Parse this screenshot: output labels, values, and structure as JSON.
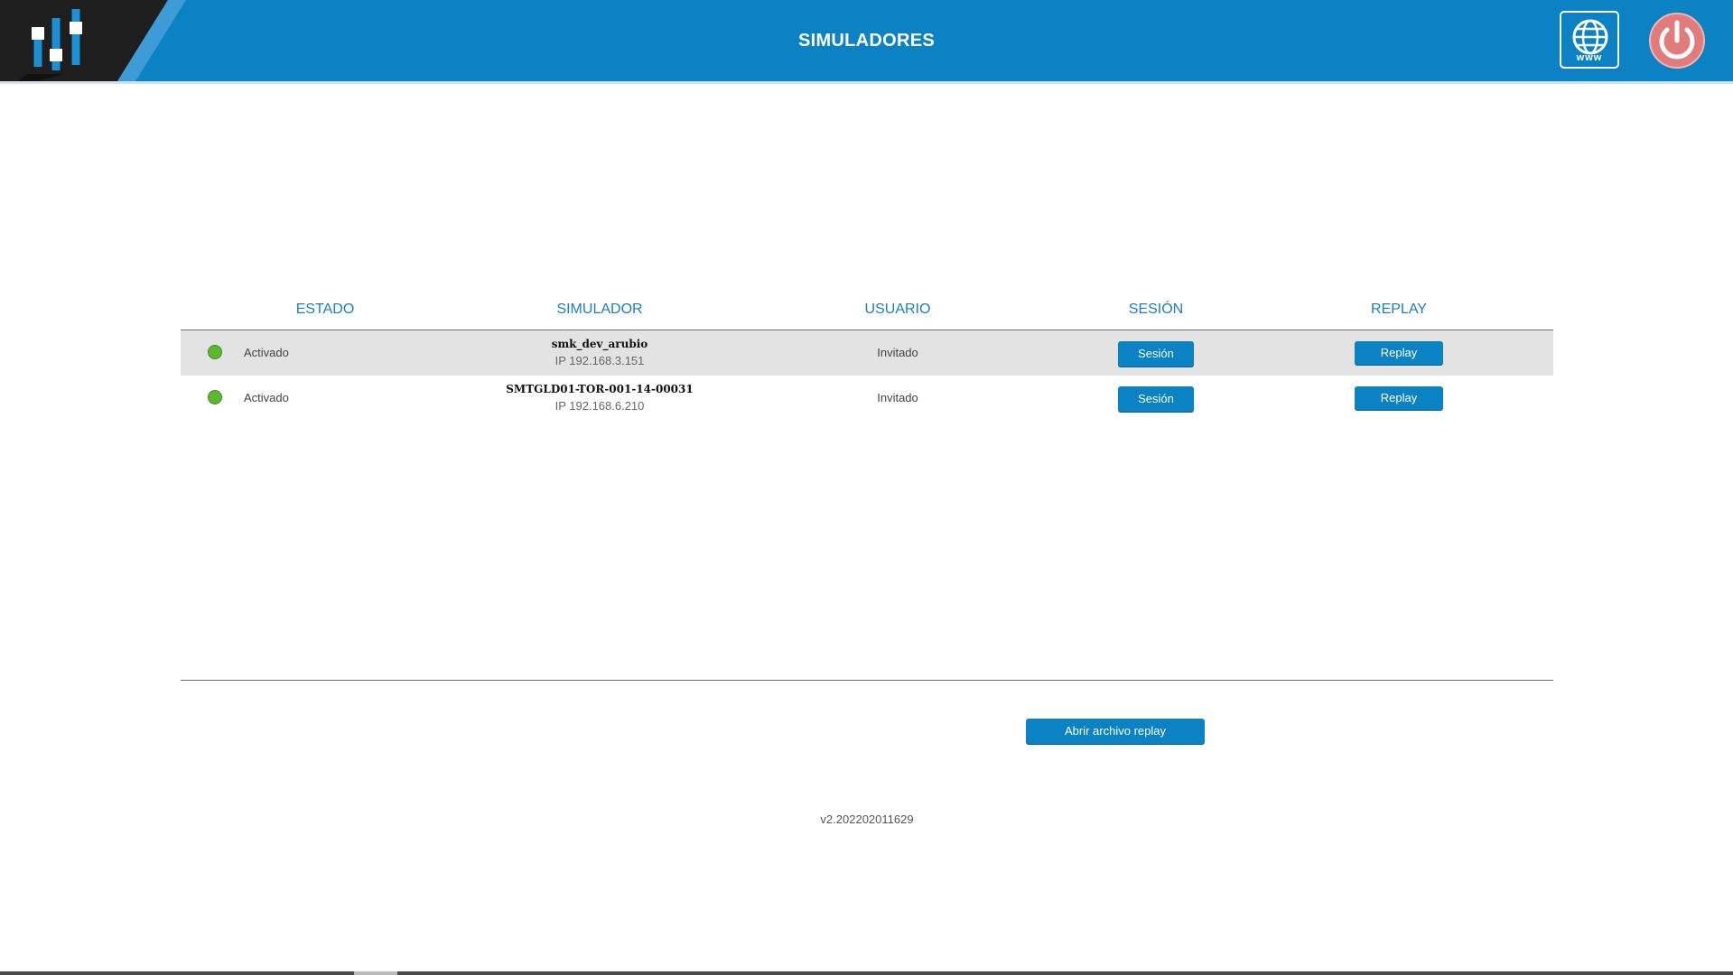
{
  "header": {
    "title": "SIMULADORES",
    "www_label": "www",
    "brand_color": "#0a82c4"
  },
  "table": {
    "columns": [
      "ESTADO",
      "SIMULADOR",
      "USUARIO",
      "SESIÓN",
      "REPLAY"
    ],
    "rows": [
      {
        "status": "Activado",
        "status_color": "#5cb82f",
        "simulator": "smk_dev_arubio",
        "ip": "IP 192.168.3.151",
        "user": "Invitado",
        "session_label": "Sesión",
        "replay_label": "Replay"
      },
      {
        "status": "Activado",
        "status_color": "#5cb82f",
        "simulator": "SMTGLD01-TOR-001-14-00031",
        "ip": "IP 192.168.6.210",
        "user": "Invitado",
        "session_label": "Sesión",
        "replay_label": "Replay"
      }
    ]
  },
  "actions": {
    "open_replay_label": "Abrir archivo replay"
  },
  "footer": {
    "version": "v2.202202011629"
  }
}
